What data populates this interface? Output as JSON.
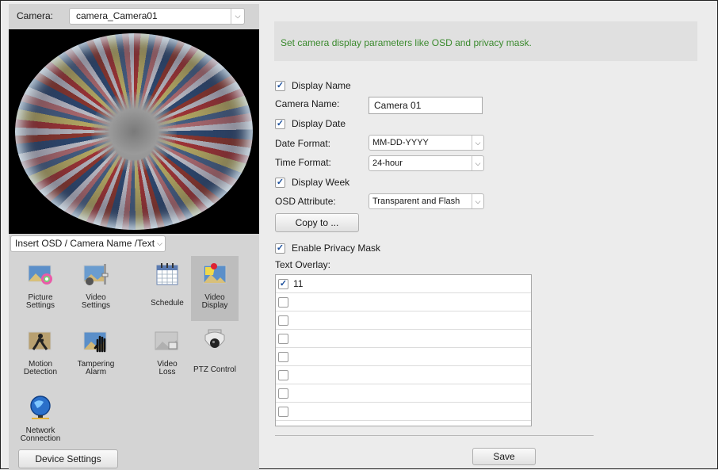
{
  "camera_bar": {
    "label": "Camera:",
    "selected": "camera_Camera01"
  },
  "insert_select": {
    "selected": "Insert OSD / Camera Name /Text"
  },
  "tools": [
    {
      "name": "picture-settings",
      "label_line1": "Picture",
      "label_line2": "Settings",
      "icon": "picture-settings-icon"
    },
    {
      "name": "video-settings",
      "label_line1": "Video",
      "label_line2": "Settings",
      "icon": "video-settings-icon"
    },
    {
      "name": "schedule",
      "label_line1": "Schedule",
      "label_line2": "",
      "icon": "calendar-icon"
    },
    {
      "name": "video-display",
      "label_line1": "Video",
      "label_line2": "Display",
      "icon": "video-display-icon"
    },
    {
      "name": "motion-detection",
      "label_line1": "Motion",
      "label_line2": "Detection",
      "icon": "motion-detection-icon"
    },
    {
      "name": "tampering-alarm",
      "label_line1": "Tampering",
      "label_line2": "Alarm",
      "icon": "tampering-hand-icon"
    },
    {
      "name": "video-loss",
      "label_line1": "Video",
      "label_line2": "Loss",
      "icon": "video-loss-icon"
    },
    {
      "name": "ptz-control",
      "label_line1": "PTZ Control",
      "label_line2": "",
      "icon": "ptz-dome-camera-icon"
    },
    {
      "name": "network-connection",
      "label_line1": "Network",
      "label_line2": "Connection",
      "icon": "globe-network-icon"
    }
  ],
  "device_settings_label": "Device Settings",
  "info_text": "Set camera display parameters like OSD and privacy mask.",
  "form": {
    "display_name": {
      "label": "Display Name",
      "checked": true
    },
    "camera_name": {
      "label": "Camera Name:",
      "value": "Camera 01"
    },
    "display_date": {
      "label": "Display Date",
      "checked": true
    },
    "date_format": {
      "label": "Date Format:",
      "value": "MM-DD-YYYY"
    },
    "time_format": {
      "label": "Time Format:",
      "value": "24-hour"
    },
    "display_week": {
      "label": "Display Week",
      "checked": true
    },
    "osd_attribute": {
      "label": "OSD Attribute:",
      "value": "Transparent and Flash"
    },
    "copy_to_label": "Copy to ...",
    "privacy_mask": {
      "label": "Enable Privacy Mask",
      "checked": true
    },
    "text_overlay_label": "Text Overlay:",
    "overlays": [
      {
        "checked": true,
        "text": "11"
      },
      {
        "checked": false,
        "text": ""
      },
      {
        "checked": false,
        "text": ""
      },
      {
        "checked": false,
        "text": ""
      },
      {
        "checked": false,
        "text": ""
      },
      {
        "checked": false,
        "text": ""
      },
      {
        "checked": false,
        "text": ""
      },
      {
        "checked": false,
        "text": ""
      }
    ]
  },
  "save_label": "Save",
  "colors": {
    "accent_text": "#3b8a2e",
    "check_mark": "#1b4f9c",
    "panel_bg": "#d4d4d4",
    "active_tool_bg": "#bdbdbd"
  }
}
